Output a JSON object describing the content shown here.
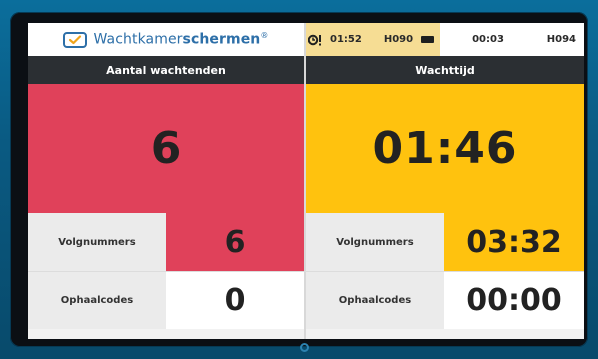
{
  "header": {
    "logo": {
      "part1": "Wachtkamer",
      "part2": "schermen",
      "reg": "®"
    },
    "ticker": {
      "alert_icon": "alarm-icon",
      "time1": "01:52",
      "code1": "H090",
      "queue_icon": "queue-icon",
      "time2": "00:03",
      "code2": "H094"
    }
  },
  "left": {
    "title": "Aantal wachtenden",
    "big_value": "6",
    "rows": [
      {
        "label": "Volgnummers",
        "value": "6"
      },
      {
        "label": "Ophaalcodes",
        "value": "0"
      }
    ]
  },
  "right": {
    "title": "Wachttijd",
    "big_value": "01:46",
    "rows": [
      {
        "label": "Volgnummers",
        "value": "03:32"
      },
      {
        "label": "Ophaalcodes",
        "value": "00:00"
      }
    ]
  },
  "colors": {
    "red": "#e0415a",
    "yellow": "#ffc20e",
    "dark_header": "#2b2f33",
    "brand_blue": "#2d6fa8"
  }
}
